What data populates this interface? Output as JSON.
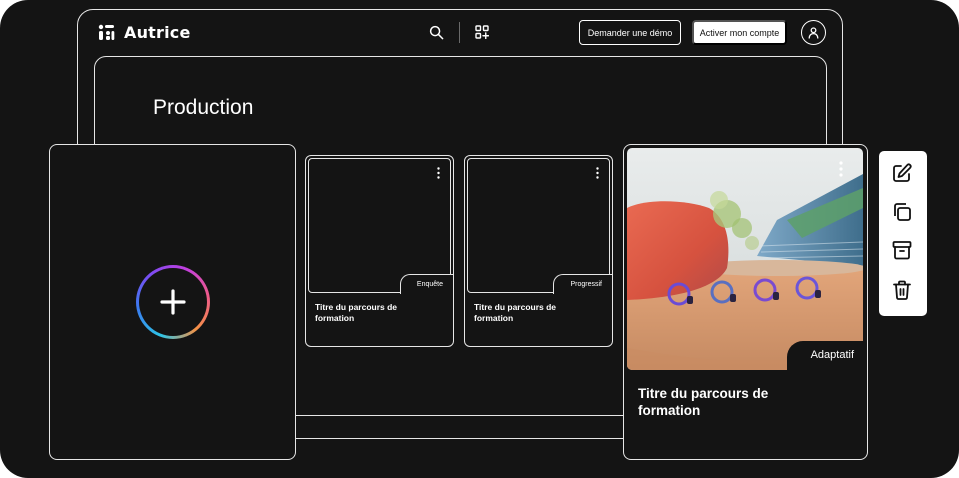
{
  "header": {
    "brand": "Autrice",
    "demo_button": "Demander une démo",
    "activate_button": "Activer mon compte"
  },
  "page": {
    "title": "Production"
  },
  "courses": [
    {
      "title": "Titre du parcours de formation",
      "tag": "Enquête"
    },
    {
      "title": "Titre du parcours de formation",
      "tag": "Progressif"
    }
  ],
  "featured": {
    "title": "Titre du parcours de formation",
    "tag": "Adaptatif"
  },
  "icons": {
    "logo": "logo-mark-icon",
    "search": "search-icon",
    "apps": "apps-grid-icon",
    "avatar": "user-icon",
    "create": "plus-icon",
    "more": "kebab-menu-icon",
    "edit": "edit-icon",
    "duplicate": "copy-icon",
    "archive": "archive-icon",
    "delete": "trash-icon"
  },
  "colors": {
    "background": "#141414",
    "foreground": "#ffffff",
    "border": "#e6e6e6"
  }
}
